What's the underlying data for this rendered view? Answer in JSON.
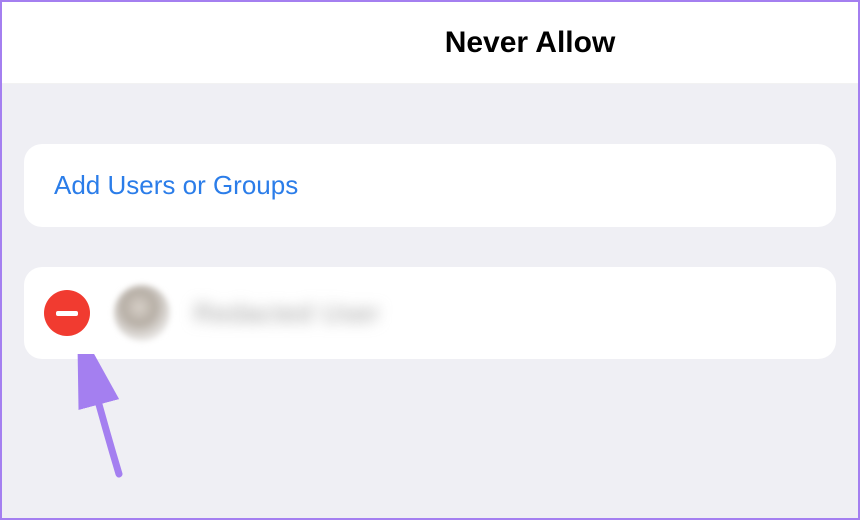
{
  "header": {
    "title": "Never Allow"
  },
  "add_section": {
    "label": "Add Users or Groups"
  },
  "list": {
    "items": [
      {
        "name": "Redacted User"
      }
    ]
  },
  "icons": {
    "delete": "minus-circle-icon",
    "arrow": "pointer-arrow-icon"
  },
  "colors": {
    "accent_blue": "#2b7de9",
    "delete_red": "#f13b30",
    "arrow_purple": "#a47ff0"
  }
}
